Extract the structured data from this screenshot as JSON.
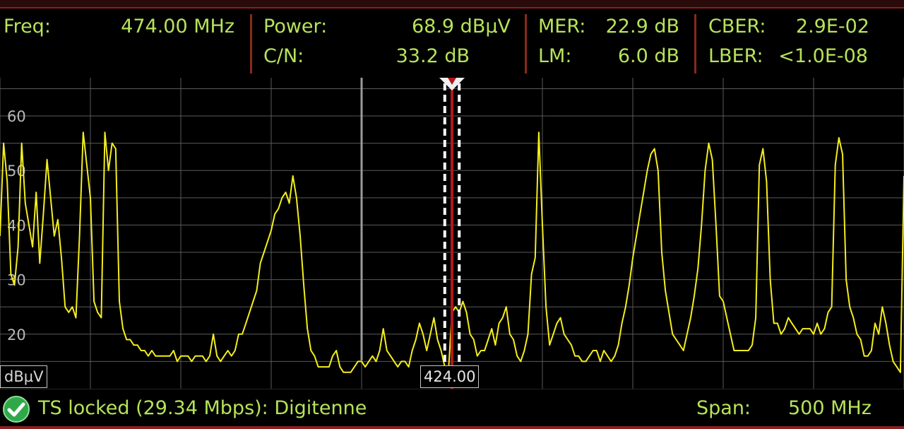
{
  "readout": {
    "freq": {
      "label": "Freq:",
      "value": "474.00 MHz"
    },
    "power": {
      "label": "Power:",
      "value": "68.9 dBµV"
    },
    "cn": {
      "label": "C/N:",
      "value": "33.2 dB"
    },
    "mer": {
      "label": "MER:",
      "value": "22.9 dB"
    },
    "lm": {
      "label": "LM:",
      "value": "6.0 dB"
    },
    "cber": {
      "label": "CBER:",
      "value": "2.9E-02"
    },
    "lber": {
      "label": "LBER:",
      "value": "<1.0E-08"
    }
  },
  "plot": {
    "scale_unit": "dBµV",
    "cursor_freq": "424.00",
    "colors": {
      "trace": "#f4ee1c",
      "grid": "#5a5a5a",
      "marker": "#b01818",
      "channel_band": "#ffffff",
      "cursor_line": "#9a9a9a"
    }
  },
  "chart_data": {
    "type": "line",
    "ylabel": "dBµV",
    "y_ticks": [
      20,
      30,
      40,
      50,
      60
    ],
    "y_range": [
      10,
      67
    ],
    "x_range_mhz": [
      224,
      724
    ],
    "center_mhz": 474.0,
    "span_mhz": 500,
    "channel_band_mhz": [
      470,
      478
    ],
    "cursor_mhz": 424.0,
    "series": [
      {
        "values": [
          [
            224,
            38
          ],
          [
            226,
            55
          ],
          [
            228,
            48
          ],
          [
            230,
            31
          ],
          [
            232,
            29
          ],
          [
            234,
            36
          ],
          [
            236,
            55
          ],
          [
            238,
            44
          ],
          [
            240,
            40
          ],
          [
            242,
            36
          ],
          [
            244,
            46
          ],
          [
            246,
            33
          ],
          [
            248,
            42
          ],
          [
            250,
            52
          ],
          [
            252,
            45
          ],
          [
            254,
            38
          ],
          [
            256,
            41
          ],
          [
            258,
            34
          ],
          [
            260,
            25
          ],
          [
            262,
            24
          ],
          [
            264,
            25
          ],
          [
            266,
            23
          ],
          [
            268,
            38
          ],
          [
            270,
            57
          ],
          [
            272,
            51
          ],
          [
            274,
            45
          ],
          [
            276,
            26
          ],
          [
            278,
            24
          ],
          [
            280,
            23
          ],
          [
            282,
            57
          ],
          [
            284,
            50
          ],
          [
            286,
            55
          ],
          [
            288,
            54
          ],
          [
            290,
            26
          ],
          [
            292,
            21
          ],
          [
            294,
            19
          ],
          [
            296,
            19
          ],
          [
            298,
            18
          ],
          [
            300,
            18
          ],
          [
            302,
            17
          ],
          [
            304,
            17
          ],
          [
            306,
            16
          ],
          [
            308,
            17
          ],
          [
            310,
            16
          ],
          [
            312,
            16
          ],
          [
            314,
            16
          ],
          [
            316,
            16
          ],
          [
            318,
            16
          ],
          [
            320,
            17
          ],
          [
            322,
            15
          ],
          [
            324,
            16
          ],
          [
            326,
            16
          ],
          [
            328,
            16
          ],
          [
            330,
            15
          ],
          [
            332,
            16
          ],
          [
            334,
            16
          ],
          [
            336,
            16
          ],
          [
            338,
            15
          ],
          [
            340,
            16
          ],
          [
            342,
            20
          ],
          [
            344,
            16
          ],
          [
            346,
            15
          ],
          [
            348,
            16
          ],
          [
            350,
            17
          ],
          [
            352,
            16
          ],
          [
            354,
            17
          ],
          [
            356,
            20
          ],
          [
            358,
            20
          ],
          [
            360,
            22
          ],
          [
            362,
            24
          ],
          [
            364,
            26
          ],
          [
            366,
            28
          ],
          [
            368,
            33
          ],
          [
            370,
            35
          ],
          [
            372,
            37
          ],
          [
            374,
            39
          ],
          [
            376,
            42
          ],
          [
            378,
            43
          ],
          [
            380,
            45
          ],
          [
            382,
            46
          ],
          [
            384,
            44
          ],
          [
            386,
            49
          ],
          [
            388,
            45
          ],
          [
            390,
            38
          ],
          [
            392,
            29
          ],
          [
            394,
            21
          ],
          [
            396,
            17
          ],
          [
            398,
            16
          ],
          [
            400,
            14
          ],
          [
            402,
            14
          ],
          [
            404,
            14
          ],
          [
            406,
            14
          ],
          [
            408,
            16
          ],
          [
            410,
            17
          ],
          [
            412,
            14
          ],
          [
            414,
            13
          ],
          [
            416,
            13
          ],
          [
            418,
            13
          ],
          [
            420,
            14
          ],
          [
            422,
            15
          ],
          [
            424,
            15
          ],
          [
            426,
            14
          ],
          [
            428,
            15
          ],
          [
            430,
            16
          ],
          [
            432,
            15
          ],
          [
            434,
            17
          ],
          [
            436,
            21
          ],
          [
            438,
            17
          ],
          [
            440,
            16
          ],
          [
            442,
            15
          ],
          [
            444,
            14
          ],
          [
            446,
            15
          ],
          [
            448,
            15
          ],
          [
            450,
            14
          ],
          [
            452,
            17
          ],
          [
            454,
            19
          ],
          [
            456,
            22
          ],
          [
            458,
            20
          ],
          [
            460,
            17
          ],
          [
            462,
            20
          ],
          [
            464,
            23
          ],
          [
            466,
            19
          ],
          [
            468,
            17
          ],
          [
            470,
            14
          ],
          [
            472,
            13
          ],
          [
            474,
            24
          ],
          [
            476,
            25
          ],
          [
            478,
            24
          ],
          [
            480,
            26
          ],
          [
            482,
            24
          ],
          [
            484,
            20
          ],
          [
            486,
            19
          ],
          [
            488,
            16
          ],
          [
            490,
            17
          ],
          [
            492,
            17
          ],
          [
            494,
            19
          ],
          [
            496,
            21
          ],
          [
            498,
            18
          ],
          [
            500,
            22
          ],
          [
            502,
            23
          ],
          [
            504,
            25
          ],
          [
            506,
            20
          ],
          [
            508,
            19
          ],
          [
            510,
            16
          ],
          [
            512,
            15
          ],
          [
            514,
            17
          ],
          [
            516,
            20
          ],
          [
            518,
            31
          ],
          [
            520,
            34
          ],
          [
            522,
            57
          ],
          [
            524,
            40
          ],
          [
            526,
            25
          ],
          [
            528,
            18
          ],
          [
            530,
            20
          ],
          [
            532,
            22
          ],
          [
            534,
            23
          ],
          [
            536,
            20
          ],
          [
            538,
            19
          ],
          [
            540,
            18
          ],
          [
            542,
            16
          ],
          [
            544,
            16
          ],
          [
            546,
            15
          ],
          [
            548,
            15
          ],
          [
            550,
            16
          ],
          [
            552,
            17
          ],
          [
            554,
            17
          ],
          [
            556,
            15
          ],
          [
            558,
            17
          ],
          [
            560,
            16
          ],
          [
            562,
            15
          ],
          [
            564,
            16
          ],
          [
            566,
            18
          ],
          [
            568,
            22
          ],
          [
            570,
            25
          ],
          [
            572,
            29
          ],
          [
            574,
            34
          ],
          [
            576,
            38
          ],
          [
            578,
            42
          ],
          [
            580,
            46
          ],
          [
            582,
            50
          ],
          [
            584,
            53
          ],
          [
            586,
            54
          ],
          [
            588,
            50
          ],
          [
            590,
            35
          ],
          [
            592,
            28
          ],
          [
            594,
            24
          ],
          [
            596,
            20
          ],
          [
            598,
            19
          ],
          [
            600,
            18
          ],
          [
            602,
            17
          ],
          [
            604,
            20
          ],
          [
            606,
            23
          ],
          [
            608,
            27
          ],
          [
            610,
            32
          ],
          [
            612,
            40
          ],
          [
            614,
            50
          ],
          [
            616,
            55
          ],
          [
            618,
            52
          ],
          [
            620,
            40
          ],
          [
            622,
            27
          ],
          [
            624,
            26
          ],
          [
            626,
            23
          ],
          [
            628,
            20
          ],
          [
            630,
            17
          ],
          [
            632,
            17
          ],
          [
            634,
            17
          ],
          [
            636,
            17
          ],
          [
            638,
            17
          ],
          [
            640,
            18
          ],
          [
            642,
            23
          ],
          [
            644,
            51
          ],
          [
            646,
            54
          ],
          [
            648,
            48
          ],
          [
            650,
            30
          ],
          [
            652,
            22
          ],
          [
            654,
            22
          ],
          [
            656,
            20
          ],
          [
            658,
            21
          ],
          [
            660,
            23
          ],
          [
            662,
            22
          ],
          [
            664,
            21
          ],
          [
            666,
            20
          ],
          [
            668,
            21
          ],
          [
            670,
            21
          ],
          [
            672,
            21
          ],
          [
            674,
            20
          ],
          [
            676,
            22
          ],
          [
            678,
            20
          ],
          [
            680,
            21
          ],
          [
            682,
            24
          ],
          [
            684,
            25
          ],
          [
            686,
            51
          ],
          [
            688,
            56
          ],
          [
            690,
            53
          ],
          [
            692,
            30
          ],
          [
            694,
            25
          ],
          [
            696,
            23
          ],
          [
            698,
            20
          ],
          [
            700,
            19
          ],
          [
            702,
            16
          ],
          [
            704,
            16
          ],
          [
            706,
            17
          ],
          [
            708,
            22
          ],
          [
            710,
            20
          ],
          [
            712,
            25
          ],
          [
            714,
            22
          ],
          [
            716,
            18
          ],
          [
            718,
            15
          ],
          [
            720,
            14
          ],
          [
            722,
            13
          ],
          [
            724,
            49
          ]
        ]
      }
    ]
  },
  "status": {
    "text": "TS locked (29.34 Mbps): Digitenne",
    "span_label": "Span:",
    "span_value": "500 MHz",
    "icon": "check-circle-icon"
  }
}
